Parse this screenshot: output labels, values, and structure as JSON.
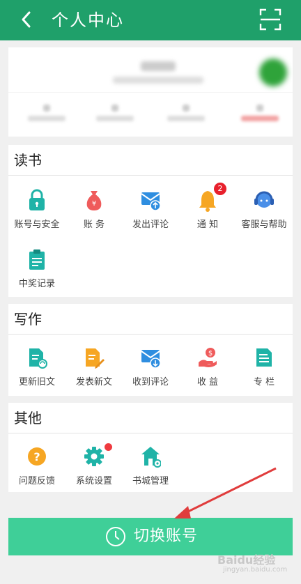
{
  "header": {
    "title": "个人中心",
    "back_icon": "chevron-left-icon",
    "scan_icon": "scan-icon"
  },
  "sections": {
    "reading": {
      "title": "读书",
      "items": [
        {
          "label": "账号与安全",
          "icon": "lock-icon",
          "color": "#1fb3a7"
        },
        {
          "label": "账  务",
          "icon": "money-bag-icon",
          "color": "#ef5b5b"
        },
        {
          "label": "发出评论",
          "icon": "mail-send-icon",
          "color": "#2f8ee0"
        },
        {
          "label": "通  知",
          "icon": "bell-icon",
          "color": "#f6a623",
          "badge": "2"
        },
        {
          "label": "客服与帮助",
          "icon": "headset-icon",
          "color": "#4a8fe8"
        },
        {
          "label": "中奖记录",
          "icon": "clipboard-icon",
          "color": "#1fb3a7"
        }
      ]
    },
    "writing": {
      "title": "写作",
      "items": [
        {
          "label": "更新旧文",
          "icon": "doc-refresh-icon",
          "color": "#1fb3a7"
        },
        {
          "label": "发表新文",
          "icon": "doc-edit-icon",
          "color": "#f6a623"
        },
        {
          "label": "收到评论",
          "icon": "mail-receive-icon",
          "color": "#2f8ee0"
        },
        {
          "label": "收  益",
          "icon": "hand-money-icon",
          "color": "#ef5b5b"
        },
        {
          "label": "专  栏",
          "icon": "column-doc-icon",
          "color": "#1fb3a7"
        }
      ]
    },
    "other": {
      "title": "其他",
      "items": [
        {
          "label": "问题反馈",
          "icon": "question-icon",
          "color": "#f6a623"
        },
        {
          "label": "系统设置",
          "icon": "gear-icon",
          "color": "#1fb3a7"
        },
        {
          "label": "书城管理",
          "icon": "house-gear-icon",
          "color": "#1fb3a7"
        }
      ]
    }
  },
  "switch_account": {
    "label": "切换账号",
    "icon": "clock-icon"
  },
  "watermark": {
    "brand": "Baidu经验",
    "url": "jingyan.baidu.com"
  },
  "colors": {
    "header": "#1fa06a",
    "switch_button": "#3fcf98",
    "annotation_arrow": "#e03c3c"
  }
}
